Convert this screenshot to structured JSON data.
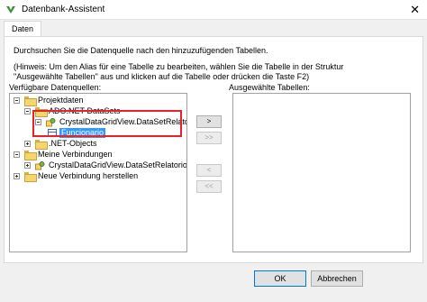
{
  "window": {
    "title": "Datenbank-Assistent",
    "close_glyph": "✕",
    "icon": "crystal-reports-icon"
  },
  "tabs": [
    {
      "label": "Daten"
    }
  ],
  "instructions": {
    "intro": "Durchsuchen Sie die Datenquelle nach den hinzuzufügenden Tabellen.",
    "hint_line1": "(Hinweis: Um den Alias für eine Tabelle zu bearbeiten, wählen Sie die Tabelle in der Struktur",
    "hint_line2": "\"Ausgewählte Tabellen\" aus und klicken auf die Tabelle oder drücken die Taste F2)"
  },
  "available": {
    "label": "Verfügbare Datenquellen:",
    "tree": {
      "projektdaten": "Projektdaten",
      "ado_net_datasets": "ADO.NET-DataSets",
      "dataset": "CrystalDataGridView.DataSetRelatorio",
      "table": "Funcionario",
      "net_objects": ".NET-Objects",
      "meine_verbindungen": "Meine Verbindungen",
      "verbindung_dataset": "CrystalDataGridView.DataSetRelatorio",
      "neue_verbindung": "Neue Verbindung herstellen"
    }
  },
  "selected": {
    "label": "Ausgewählte Tabellen:",
    "items": []
  },
  "transfer_buttons": {
    "add": ">",
    "add_all": ">>",
    "remove": "<",
    "remove_all": "<<"
  },
  "footer": {
    "ok": "OK",
    "cancel": "Abbrechen"
  },
  "colors": {
    "highlight_border": "#e8212a",
    "selection": "#3399ff",
    "folder": "#f5d56e"
  }
}
